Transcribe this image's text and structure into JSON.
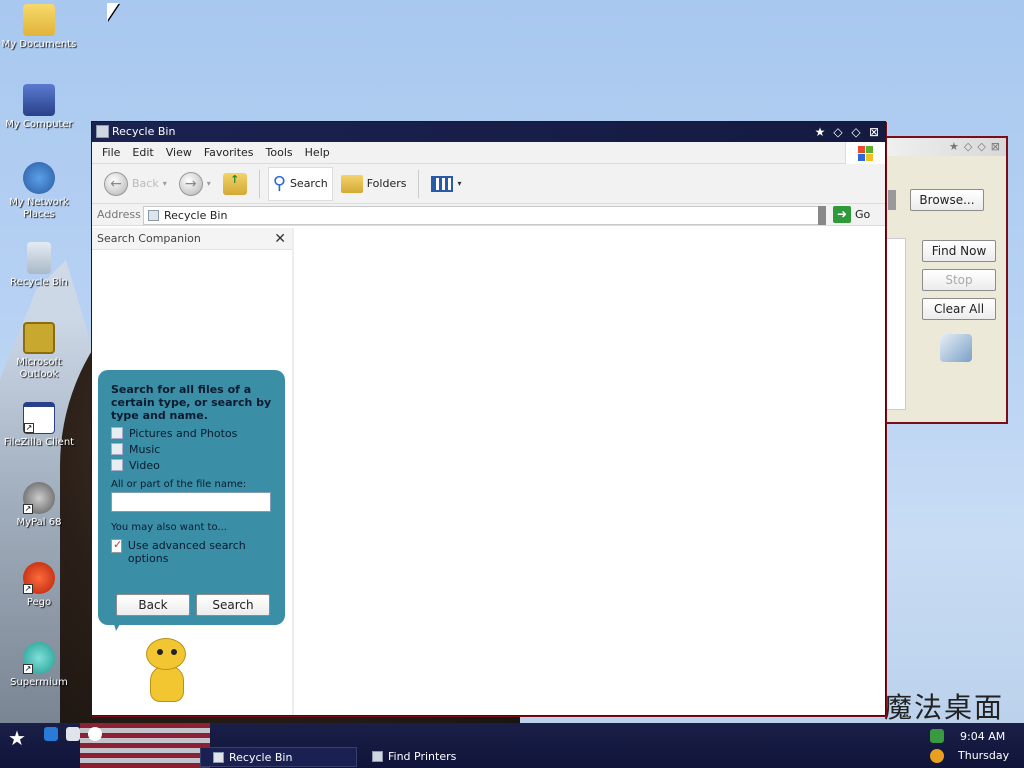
{
  "desktop": {
    "icons": [
      {
        "label": "My Documents"
      },
      {
        "label": "My Computer"
      },
      {
        "label": "My Network Places"
      },
      {
        "label": "Recycle Bin"
      },
      {
        "label": "Microsoft Outlook"
      },
      {
        "label": "FileZilla Client"
      },
      {
        "label": "MyPal 68"
      },
      {
        "label": "Pego"
      },
      {
        "label": "Supermium"
      }
    ]
  },
  "back_window": {
    "buttons": [
      "Browse...",
      "Find Now",
      "Stop",
      "Clear All"
    ]
  },
  "window": {
    "title": "Recycle Bin",
    "menu": [
      "File",
      "Edit",
      "View",
      "Favorites",
      "Tools",
      "Help"
    ],
    "toolbar": {
      "back": "Back",
      "search": "Search",
      "folders": "Folders"
    },
    "address": {
      "label": "Address",
      "value": "Recycle Bin",
      "go": "Go"
    }
  },
  "search_companion": {
    "title": "Search Companion",
    "question": "Search for all files of a certain type, or search by type and name.",
    "options": [
      "Pictures and Photos",
      "Music",
      "Video"
    ],
    "filename_label": "All or part of the file name:",
    "also_label": "You may also want to...",
    "advanced_label": "Use advanced search options",
    "back_button": "Back",
    "search_button": "Search"
  },
  "taskbar": {
    "tasks": [
      {
        "label": "Recycle Bin"
      },
      {
        "label": "Find Printers"
      }
    ],
    "clock": {
      "time": "9:04 AM",
      "day": "Thursday"
    }
  }
}
